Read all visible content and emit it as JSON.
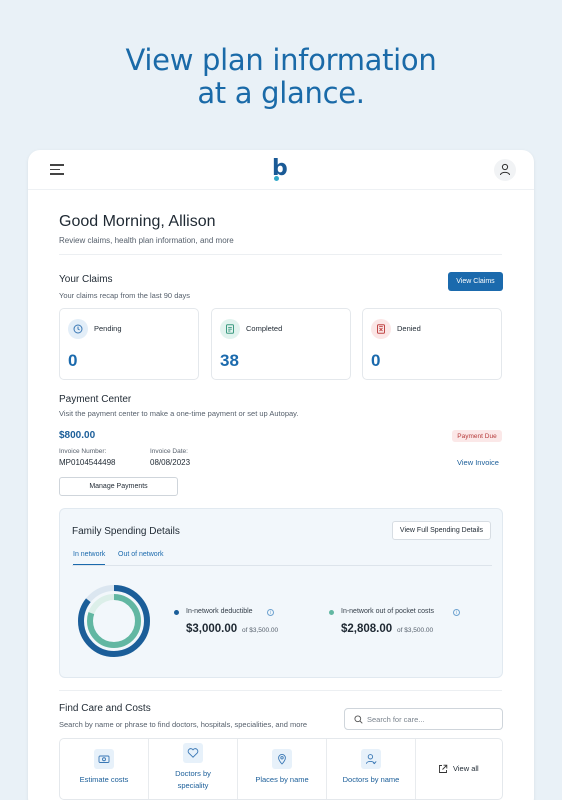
{
  "hero": {
    "line1": "View plan information",
    "line2": "at a glance."
  },
  "app": {
    "logo": "b"
  },
  "greeting": {
    "title": "Good Morning, Allison",
    "subtitle": "Review claims, health plan information, and more"
  },
  "claims": {
    "title": "Your Claims",
    "subtitle": "Your claims recap from the last 90 days",
    "button": "View Claims",
    "items": [
      {
        "label": "Pending",
        "value": "0",
        "icon": "clock-icon",
        "icon_bg": "#e3eef8",
        "icon_color": "#3a78b5"
      },
      {
        "label": "Completed",
        "value": "38",
        "icon": "document-check-icon",
        "icon_bg": "#e1f3ee",
        "icon_color": "#3c9a80"
      },
      {
        "label": "Denied",
        "value": "0",
        "icon": "document-x-icon",
        "icon_bg": "#fbe6e6",
        "icon_color": "#c04646"
      }
    ]
  },
  "payment": {
    "title": "Payment Center",
    "subtitle": "Visit the payment center to make a one-time payment or set up Autopay.",
    "amount": "$800.00",
    "status": "Payment Due",
    "invoice_number_label": "Invoice Number:",
    "invoice_number": "MP0104544498",
    "invoice_date_label": "Invoice Date:",
    "invoice_date": "08/08/2023",
    "view_invoice": "View Invoice",
    "manage_button": "Manage Payments"
  },
  "spending": {
    "title": "Family Spending Details",
    "button": "View Full Spending Details",
    "tabs": [
      "In network",
      "Out of network"
    ],
    "active_tab": "In network",
    "deductible": {
      "label": "In-network deductible",
      "amount": "$3,000.00",
      "of": "of $3,500.00",
      "color": "#1b5e99",
      "fraction": 0.857
    },
    "oop": {
      "label": "In-network out of pocket costs",
      "amount": "$2,808.00",
      "of": "of $3,500.00",
      "color": "#62b7a2",
      "fraction": 0.802
    }
  },
  "care": {
    "title": "Find Care and Costs",
    "subtitle": "Search by name or phrase to find doctors, hospitals, specialities, and more",
    "search_placeholder": "Search for care...",
    "items": [
      {
        "label": "Estimate costs",
        "icon": "dollar-bill-icon"
      },
      {
        "label": "Doctors by speciality",
        "line1": "Doctors by",
        "line2": "speciality",
        "icon": "heart-icon"
      },
      {
        "label": "Places by name",
        "icon": "location-pin-icon"
      },
      {
        "label": "Doctors by name",
        "icon": "doctor-icon"
      },
      {
        "label": "View all",
        "icon": "external-link-icon"
      }
    ]
  },
  "colors": {
    "brand": "#1b6aad",
    "hero": "#1a6aa8",
    "background": "#e9f1f7"
  }
}
